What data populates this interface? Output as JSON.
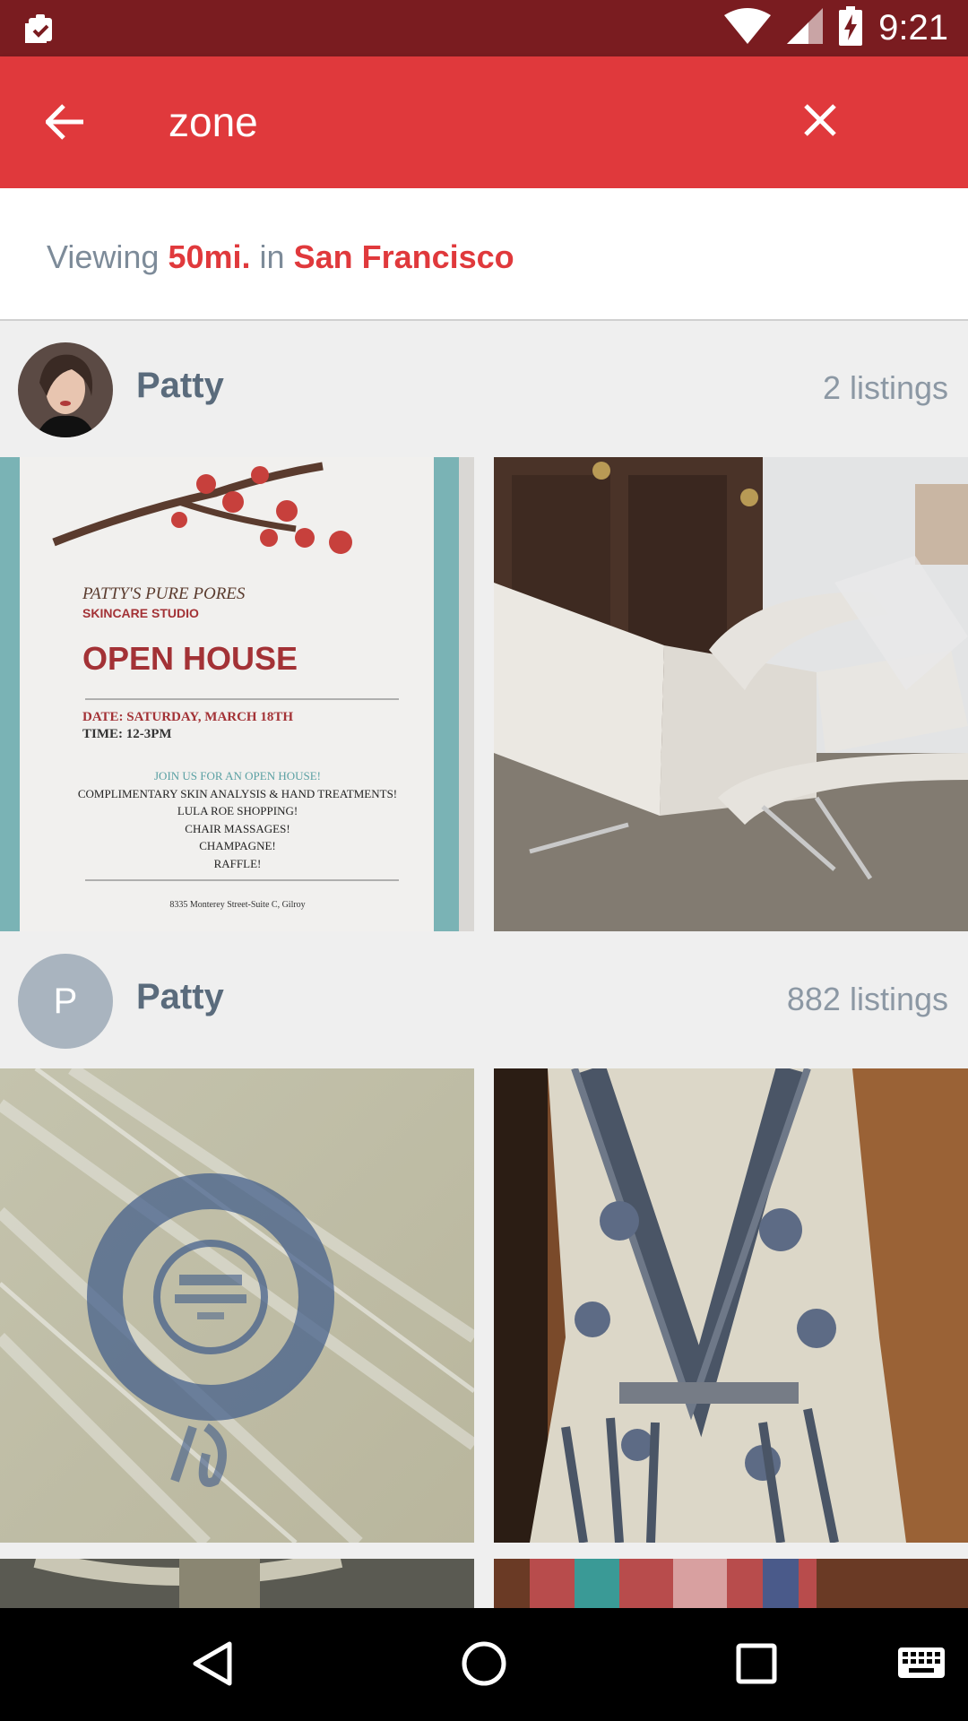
{
  "status_bar": {
    "time": "9:21",
    "icons": [
      "clipboard-check-icon",
      "wifi-icon",
      "signal-icon",
      "battery-charging-icon"
    ]
  },
  "search": {
    "value": "zone",
    "back_icon": "arrow-back-icon",
    "clear_icon": "close-icon"
  },
  "location_bar": {
    "prefix": "Viewing",
    "distance": "50mi.",
    "middle": "in",
    "city": "San Francisco"
  },
  "sellers": [
    {
      "name": "Patty",
      "listings": "2 listings",
      "avatar": "photo",
      "tiles": [
        {
          "kind": "poster",
          "script": "Patty's Pure Pores",
          "studio": "SKINCARE STUDIO",
          "headline": "OPEN HOUSE",
          "date": "Date: Saturday, March 18th",
          "time": "Time: 12-3pm",
          "lines": [
            "Join us for an open house!",
            "Complimentary Skin analysis & Hand treatments!",
            "Lula Roe shopping!",
            "Chair massages!",
            "Champagne!",
            "Raffle!"
          ],
          "address": "8335 Monterey Street-Suite C, Gilroy"
        },
        {
          "kind": "photo",
          "subject": "white reclining spa chair"
        }
      ]
    },
    {
      "name": "Patty",
      "listings": "882 listings",
      "avatar_letter": "P",
      "tiles": [
        {
          "kind": "photo",
          "subject": "blue stamped ceramic plate"
        },
        {
          "kind": "photo",
          "subject": "blue and white printed romper"
        }
      ]
    }
  ],
  "nav_bar": {
    "icons": [
      "nav-back-icon",
      "nav-home-icon",
      "nav-recents-icon",
      "keyboard-icon"
    ]
  },
  "colors": {
    "status_bar": "#7a1c20",
    "app_bar": "#e0393c",
    "accent": "#e0393c",
    "muted_text": "#7d8b99"
  }
}
